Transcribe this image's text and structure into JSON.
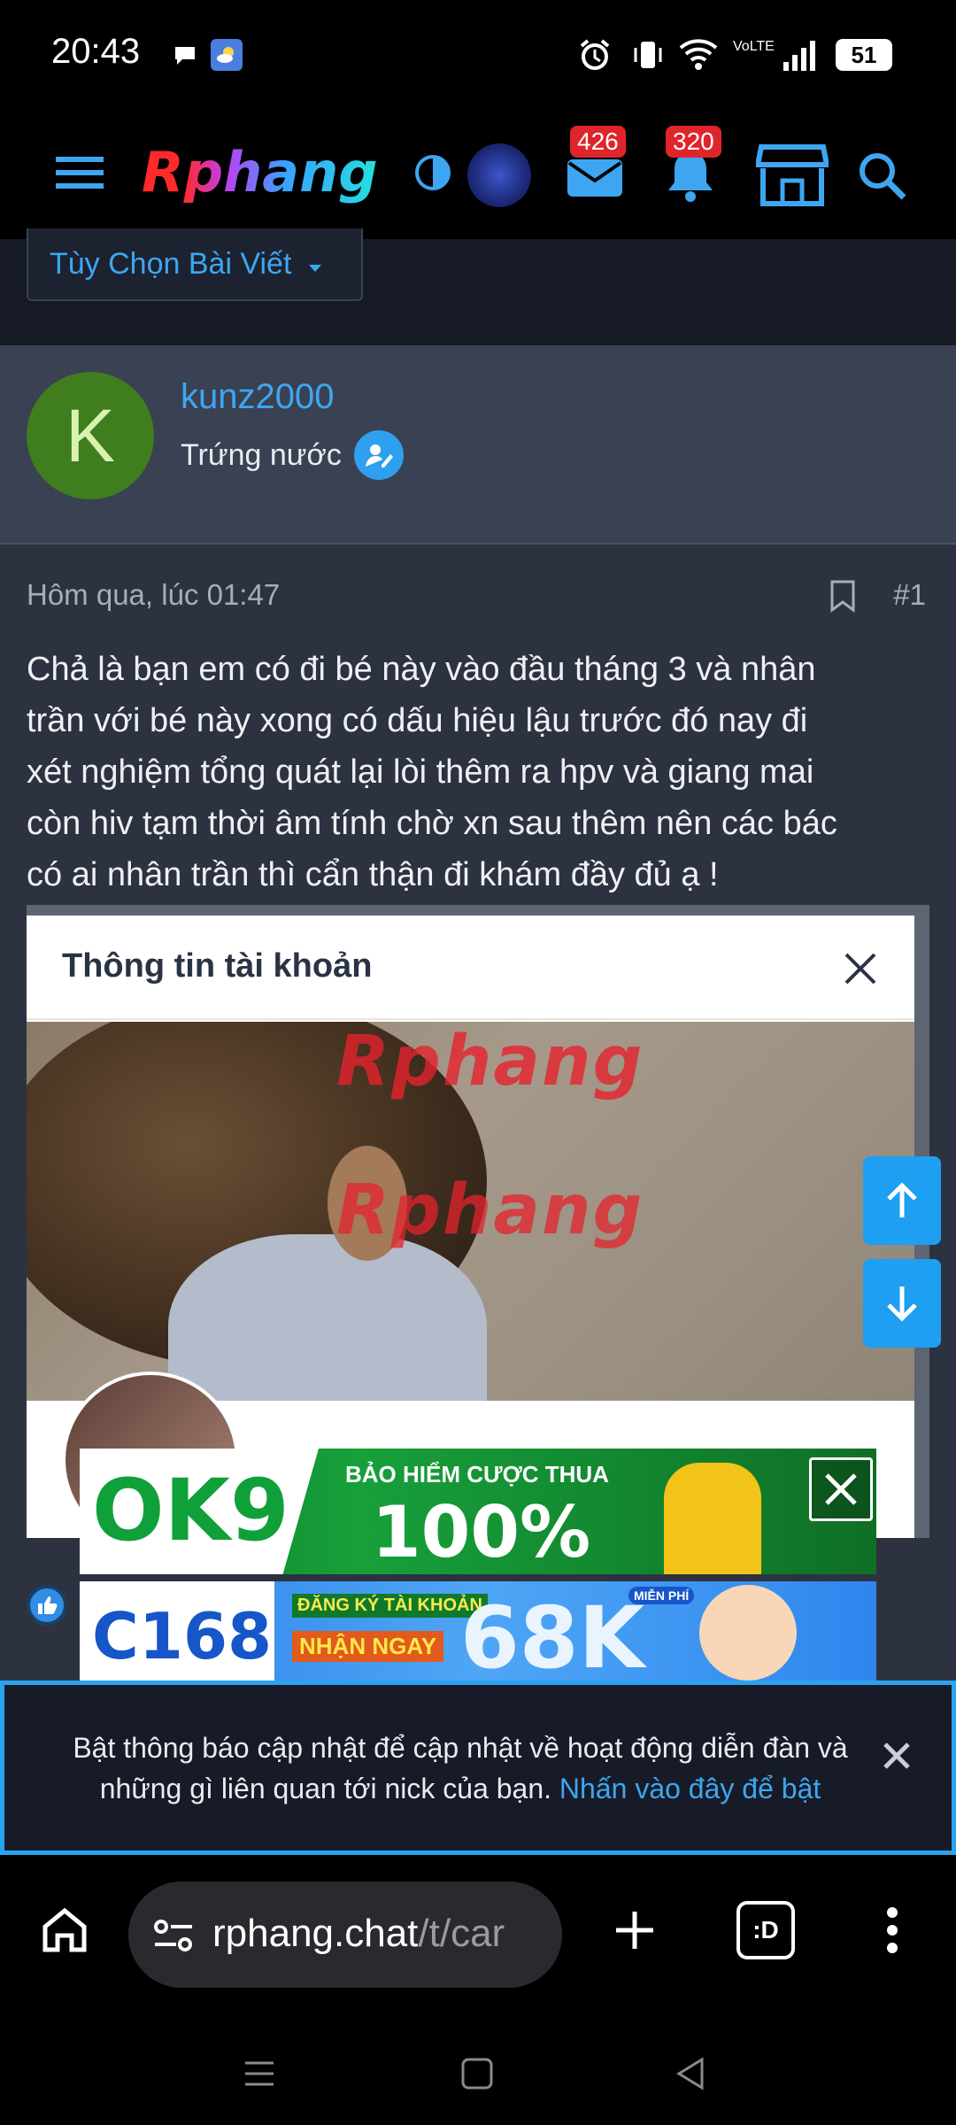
{
  "status_bar": {
    "time": "20:43",
    "battery": "51",
    "network": "VoLTE"
  },
  "header": {
    "logo_text": "Rphang",
    "messages_count": "426",
    "alerts_count": "320"
  },
  "options_button": {
    "label": "Tùy Chọn Bài Viết"
  },
  "author": {
    "avatar_letter": "K",
    "username": "kunz2000",
    "user_title": "Trứng nước"
  },
  "post": {
    "date": "Hôm qua, lúc 01:47",
    "number": "#1",
    "lines": [
      "Chả là bạn em có đi bé này vào đầu tháng 3 và nhân",
      "trần với bé này xong có dấu hiệu lậu trước đó nay đi",
      "xét nghiệm tổng quát lại lòi thêm ra hpv và giang mai",
      "còn hiv tạm thời âm tính chờ xn sau thêm nên các bác",
      "có ai nhân trần thì cẩn thận đi khám đầy đủ ạ !"
    ]
  },
  "embedded_image": {
    "modal_title": "Thông tin tài khoản",
    "watermark": "Rphang"
  },
  "ads": {
    "ad1": {
      "brand": "OK9",
      "line1": "BẢO HIỂM CƯỢC THUA",
      "line2": "100%"
    },
    "ad2": {
      "brand": "C168",
      "line1": "ĐĂNG KÝ TÀI KHOẢN",
      "line2": "NHẬN NGAY",
      "amount": "68K",
      "tag": "MIỄN PHÍ"
    }
  },
  "notification": {
    "text": "Bật thông báo cập nhật để cập nhật về hoạt động diễn đàn và những gì liên quan tới nick của bạn.",
    "link": "Nhấn vào đây để bật"
  },
  "browser": {
    "url_host": "rphang.chat",
    "url_path": "/t/car",
    "tab_label": ":D"
  },
  "colors": {
    "accent": "#3ea6f0",
    "badge": "#e0242b",
    "background": "#2c3240"
  }
}
